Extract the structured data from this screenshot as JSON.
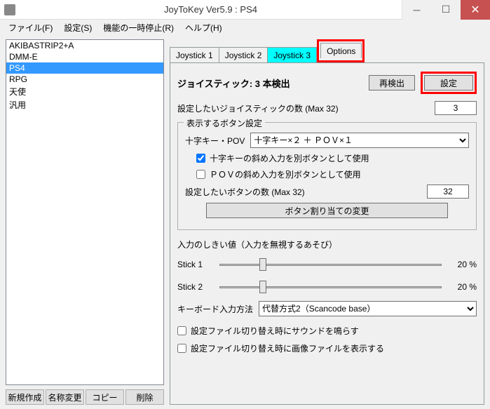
{
  "window": {
    "title": "JoyToKey Ver5.9 : PS4"
  },
  "menu": {
    "file": "ファイル(F)",
    "settings": "設定(S)",
    "pause": "機能の一時停止(R)",
    "help": "ヘルプ(H)"
  },
  "profiles": {
    "items": [
      "AKIBASTRIP2+A",
      "DMM-E",
      "PS4",
      "RPG",
      "天使",
      "汎用"
    ],
    "selected_index": 2
  },
  "left_buttons": {
    "new": "新規作成",
    "rename": "名称変更",
    "copy": "コピー",
    "delete": "削除"
  },
  "tabs": {
    "items": [
      "Joystick 1",
      "Joystick 2",
      "Joystick 3",
      "Options"
    ],
    "active_index": 2
  },
  "options": {
    "heading": "ジョイスティック: 3 本検出",
    "redetect_btn": "再検出",
    "settings_btn": "設定",
    "count_label": "設定したいジョイスティックの数 (Max 32)",
    "count_value": "3",
    "group": {
      "legend": "表示するボタン設定",
      "pov_label": "十字キー・POV",
      "pov_select": "十字キー×２ ＋ ＰＯＶ×１",
      "chk_dpad_diag": "十字キーの斜め入力を別ボタンとして使用",
      "chk_dpad_diag_val": true,
      "chk_pov_diag": "ＰＯＶの斜め入力を別ボタンとして使用",
      "chk_pov_diag_val": false,
      "btn_count_label": "設定したいボタンの数 (Max 32)",
      "btn_count_value": "32",
      "change_btn": "ボタン割り当ての変更"
    },
    "threshold_label": "入力のしきい値（入力を無視するあそび）",
    "stick1_label": "Stick 1",
    "stick1_pct": "20 %",
    "stick1_pos": 20,
    "stick2_label": "Stick 2",
    "stick2_pct": "20 %",
    "stick2_pos": 20,
    "kb_label": "キーボード入力方法",
    "kb_value": "代替方式2（Scancode base）",
    "chk_sound": "設定ファイル切り替え時にサウンドを鳴らす",
    "chk_sound_val": false,
    "chk_image": "設定ファイル切り替え時に画像ファイルを表示する",
    "chk_image_val": false
  }
}
